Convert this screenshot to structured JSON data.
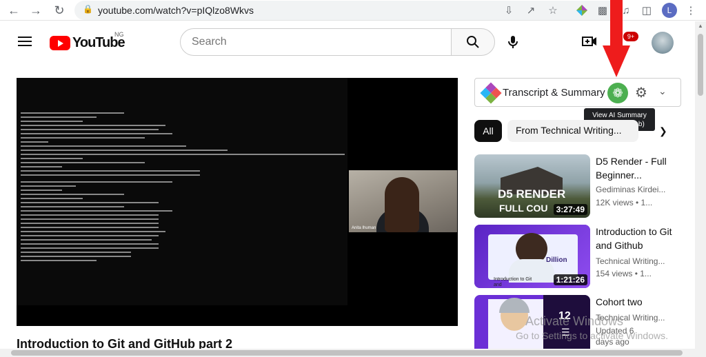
{
  "browser": {
    "url": "youtube.com/watch?v=pIQlzo8Wkvs",
    "profile_initial": "L"
  },
  "youtube": {
    "logo_text": "YouTube",
    "country": "NG",
    "search_placeholder": "Search",
    "notification_badge": "9+"
  },
  "player": {
    "webcam_label": "Anita Ihuman"
  },
  "video": {
    "title": "Introduction to Git and GitHub part 2"
  },
  "extension": {
    "title": "Transcript & Summary",
    "tooltip_line1": "View AI Summary",
    "tooltip_line2": "(Open New Tab)"
  },
  "chips": {
    "all": "All",
    "technical": "From Technical Writing..."
  },
  "recommendations": [
    {
      "title": "D5 Render - Full Beginner...",
      "channel": "Gediminas Kirdei...",
      "meta": "12K views • 1...",
      "duration": "3:27:49",
      "thumb_text": "D5 RENDER",
      "thumb_sub": "FULL COU"
    },
    {
      "title": "Introduction to Git and Github",
      "channel": "Technical Writing...",
      "meta": "154 views • 1...",
      "duration": "1:21:26",
      "thumb_name": "Dillion",
      "thumb_caption": "Introduction to Git and"
    },
    {
      "title": "Cohort two",
      "channel": "Technical Writing...",
      "meta": "Updated 6 days ago",
      "playlist_count": "12"
    }
  ],
  "watermark": {
    "line1": "Activate Windows",
    "line2": "Go to Settings to activate Windows."
  },
  "colors": {
    "youtube_red": "#ff0000",
    "ai_button": "#4caf50",
    "arrow_red": "#ee1c1c"
  }
}
